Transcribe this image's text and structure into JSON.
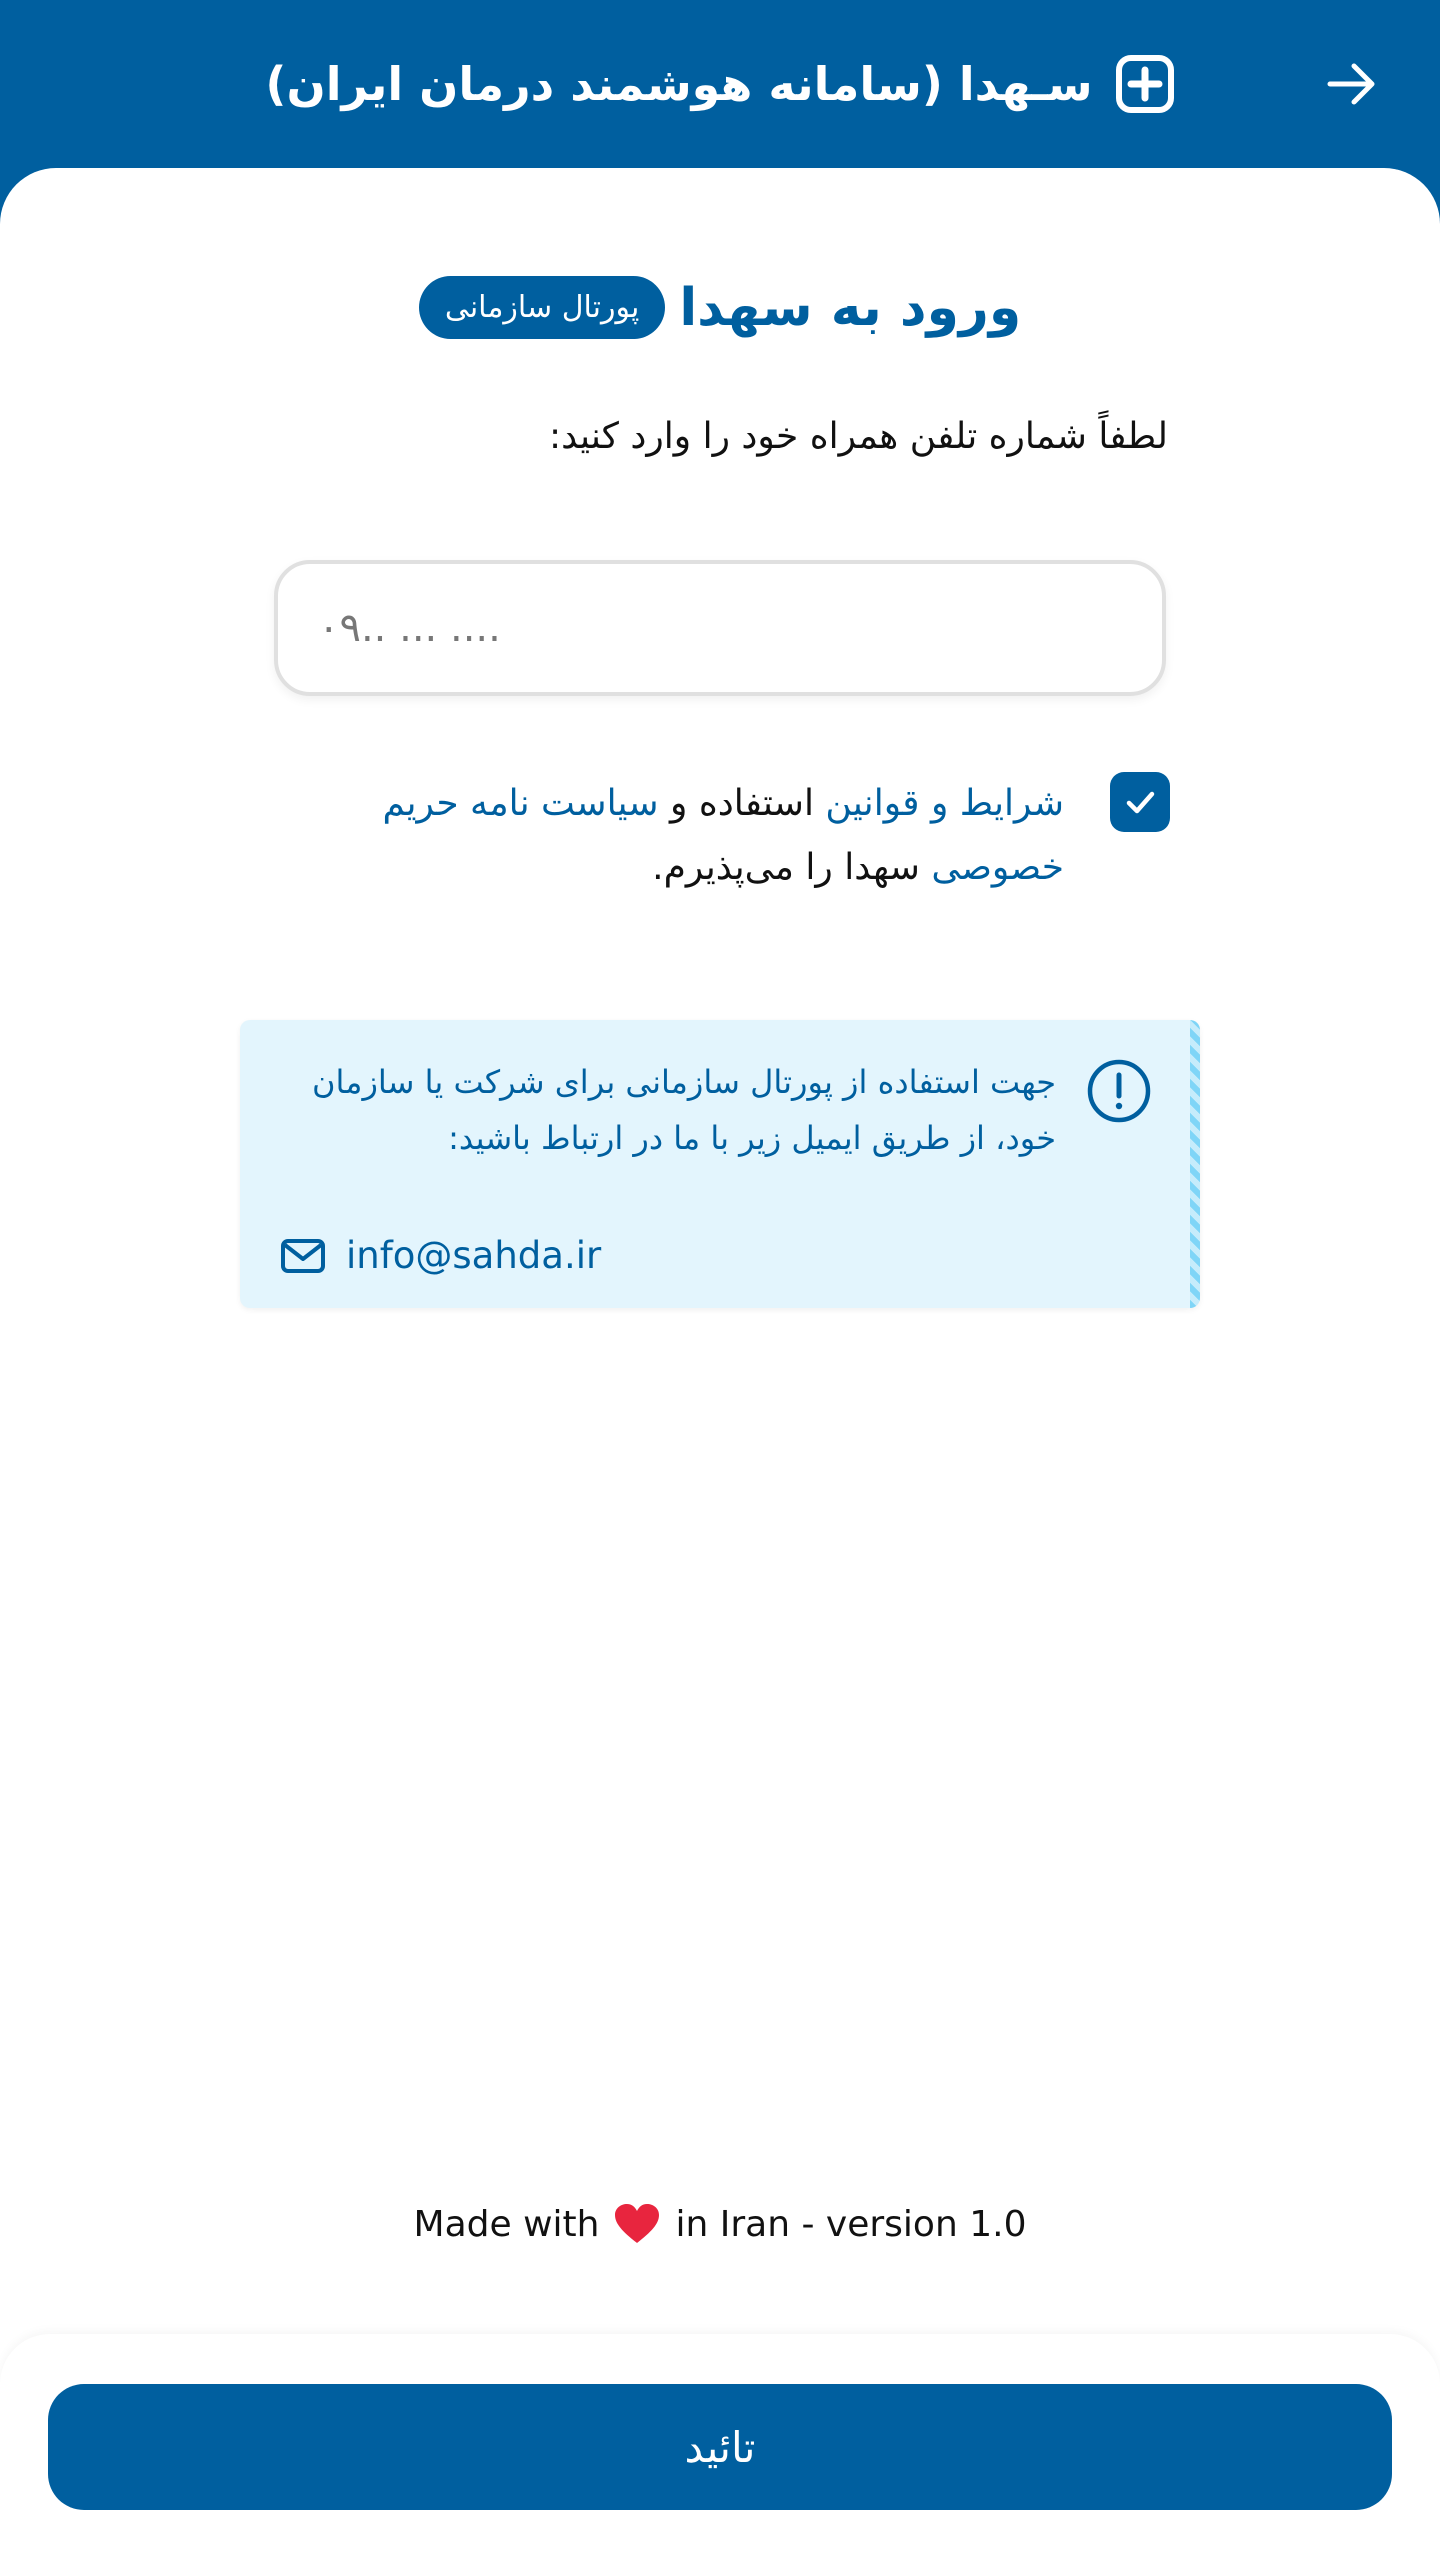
{
  "header": {
    "title": "سـهدا (سامانه هوشمند درمان ایران)",
    "back_icon": "arrow-right-icon",
    "logo_icon": "plus-square-icon"
  },
  "login": {
    "title": "ورود به سهدا",
    "badge": "پورتال سازمانی"
  },
  "form": {
    "prompt": "لطفاً شماره تلفن همراه خود را وارد کنید:",
    "phone_placeholder": "۰۹.. ... ....",
    "phone_value": ""
  },
  "agreement": {
    "checked": true,
    "terms_link": "شرایط و قوانین",
    "text_usage": " استفاده و ",
    "privacy_link": "سیاست نامه حریم خصوصی",
    "text_end": " سهدا را می‌پذیرم."
  },
  "info": {
    "text": "جهت استفاده از پورتال سازمانی برای شرکت یا سازمان خود، از طریق ایمیل زیر با ما در ارتباط باشید:",
    "email": "info@sahda.ir",
    "icon": "info-icon"
  },
  "footer": {
    "made_with": "Made with",
    "in_iran": "in Iran - version 1.0",
    "heart_icon": "heart-icon"
  },
  "actions": {
    "confirm_label": "تائید"
  },
  "colors": {
    "primary": "#005f9f",
    "info_bg": "#e3f5fd",
    "heart": "#e8253e"
  }
}
